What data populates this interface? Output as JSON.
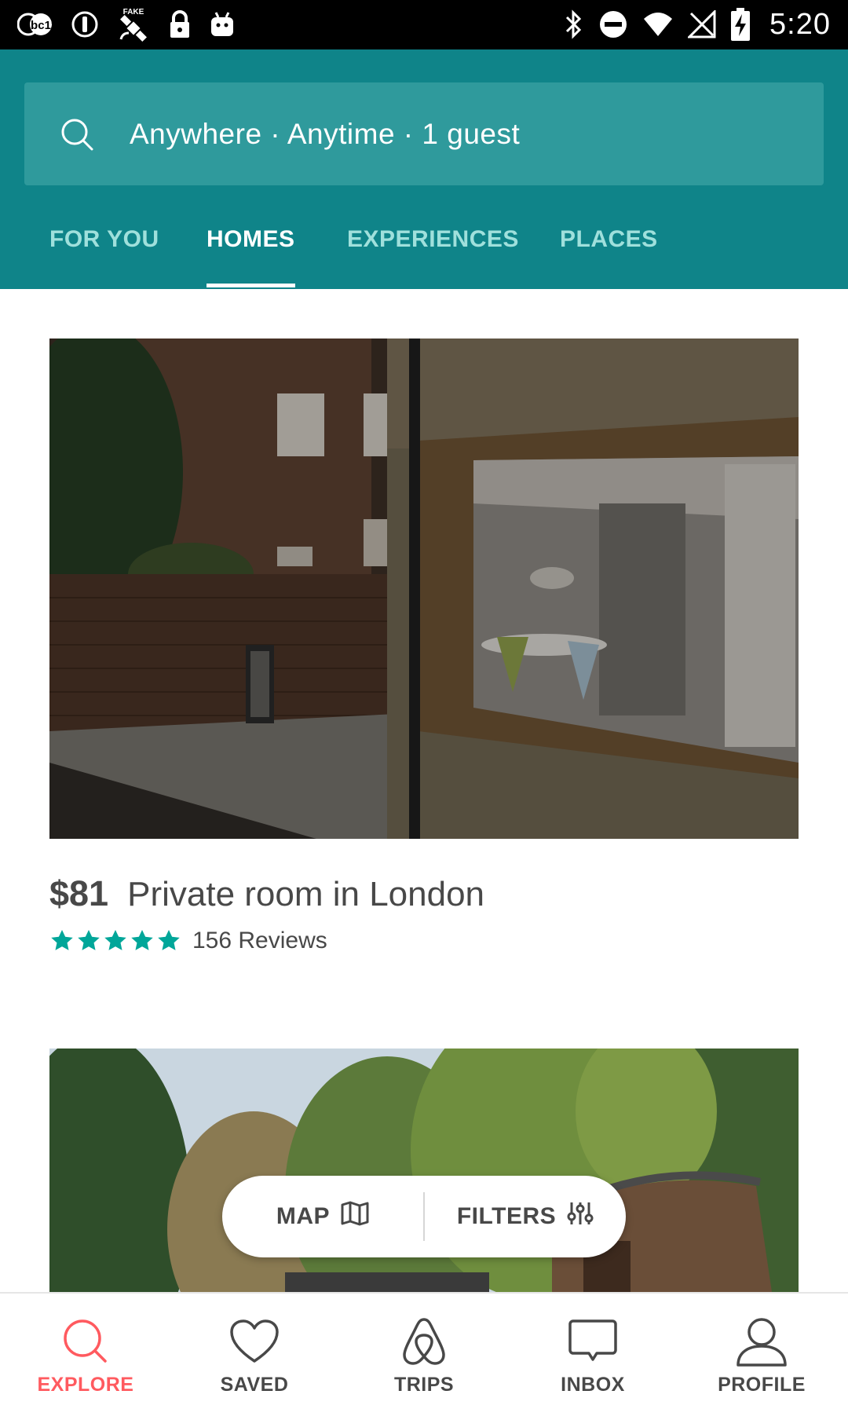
{
  "status_bar": {
    "time": "5:20",
    "left_icons": [
      "abc-13-app-icon",
      "info-circle-icon",
      "fake-gps-satellite-icon",
      "lock-icon",
      "android-icon"
    ],
    "right_icons": [
      "bluetooth-icon",
      "do-not-disturb-icon",
      "wifi-icon",
      "no-signal-icon",
      "battery-charging-icon"
    ],
    "abc_label": "abc13",
    "fake_label": "FAKE"
  },
  "search": {
    "text": "Anywhere · Anytime · 1 guest"
  },
  "tabs": [
    {
      "label": "FOR YOU",
      "active": false
    },
    {
      "label": "HOMES",
      "active": true
    },
    {
      "label": "EXPERIENCES",
      "active": false
    },
    {
      "label": "PLACES",
      "active": false
    }
  ],
  "listings": [
    {
      "price": "$81",
      "title": "Private room in London",
      "rating": 5,
      "reviews": "156 Reviews"
    }
  ],
  "pill": {
    "map_label": "MAP",
    "filters_label": "FILTERS"
  },
  "bottom_nav": [
    {
      "label": "EXPLORE",
      "icon": "search-icon",
      "active": true
    },
    {
      "label": "SAVED",
      "icon": "heart-icon",
      "active": false
    },
    {
      "label": "TRIPS",
      "icon": "airbnb-logo-icon",
      "active": false
    },
    {
      "label": "INBOX",
      "icon": "chat-bubble-icon",
      "active": false
    },
    {
      "label": "PROFILE",
      "icon": "person-icon",
      "active": false
    }
  ],
  "colors": {
    "header_bg": "#0f8489",
    "search_bg": "#2f9a9c",
    "tab_inactive": "#9fe0dc",
    "accent_teal": "#00a699",
    "accent_red": "#ff5a5f",
    "text_dark": "#484848"
  }
}
